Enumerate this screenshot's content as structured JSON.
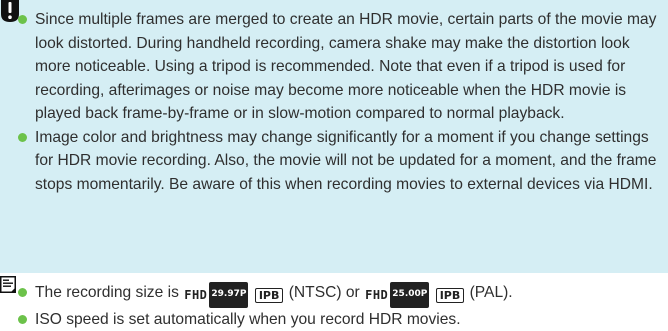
{
  "caution": {
    "icon": "caution-icon",
    "items": [
      "Since multiple frames are merged to create an HDR movie, certain parts of the movie may look distorted. During handheld recording, camera shake may make the distortion look more noticeable. Using a tripod is recommended. Note that even if a tripod is used for recording, afterimages or noise may become more noticeable when the HDR movie is played back frame-by-frame or in slow-motion compared to normal playback.",
      "Image color and brightness may change significantly for a moment if you change settings for HDR movie recording. Also, the movie will not be updated for a moment, and the frame stops momentarily. Be aware of this when recording movies to external devices via HDMI."
    ]
  },
  "note": {
    "icon": "note-icon",
    "item1": {
      "prefix": "The recording size is",
      "ntsc_fhd": "FHD",
      "ntsc_rate": "29.97P",
      "ntsc_ipb": "IPB",
      "ntsc_label": "(NTSC) or",
      "pal_fhd": "FHD",
      "pal_rate": "25.00P",
      "pal_ipb": "IPB",
      "pal_label": "(PAL)."
    },
    "item2": "ISO speed is set automatically when you record HDR movies."
  },
  "colors": {
    "caution_bg": "#d5eef4",
    "bullet": "#6cc24a",
    "text": "#2f2f2f"
  }
}
